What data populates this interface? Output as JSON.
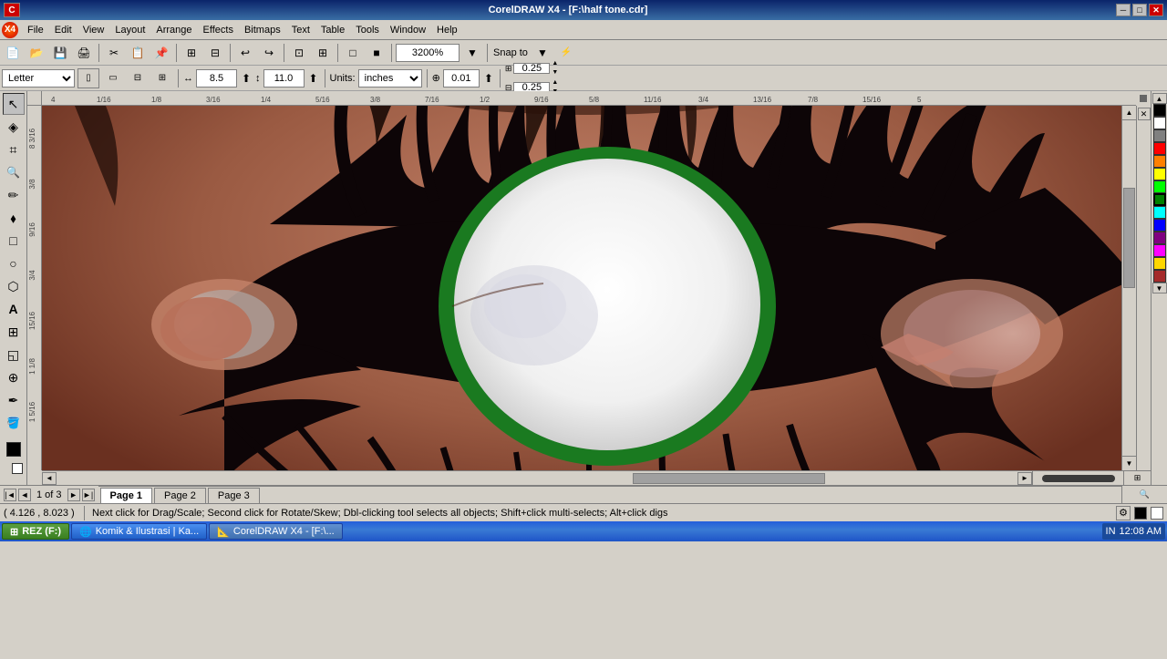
{
  "app": {
    "title": "CorelDRAW X4 - [F:\\half tone.cdr]",
    "logo": "C"
  },
  "titlebar": {
    "title": "CorelDRAW X4 - [F:\\half tone.cdr]",
    "minimize": "─",
    "maximize": "□",
    "close": "✕"
  },
  "menubar": {
    "items": [
      "File",
      "Edit",
      "View",
      "Layout",
      "Arrange",
      "Effects",
      "Bitmaps",
      "Text",
      "Table",
      "Tools",
      "Window",
      "Help"
    ]
  },
  "toolbar1": {
    "new_label": "New",
    "open_label": "Open",
    "save_label": "Save",
    "zoom_value": "3200%",
    "snap_label": "Snap to"
  },
  "toolbar2": {
    "page_size": "Letter",
    "width": "8.5",
    "height": "11.0",
    "units": "inches",
    "nudge": "0.01",
    "offset_x": "0.25",
    "offset_y": "0.25"
  },
  "pages": {
    "current": "1 of 3",
    "tabs": [
      "Page 1",
      "Page 2",
      "Page 3"
    ],
    "active": "Page 1"
  },
  "statusbar": {
    "coords": "( 4.126 , 8.023 )",
    "message": "Next click for Drag/Scale; Second click for Rotate/Skew; Dbl-clicking tool selects all objects; Shift+click multi-selects; Alt+click digs"
  },
  "taskbar": {
    "items": [
      "REZ (F:)",
      "Komik & Ilustrasi | Ka...",
      "CorelDRAW X4 - [F:\\..."
    ],
    "time": "12:08 AM",
    "lang": "IN"
  },
  "palette": {
    "colors": [
      "#000000",
      "#FFFFFF",
      "#FF0000",
      "#00FF00",
      "#0000FF",
      "#FFFF00",
      "#FF00FF",
      "#00FFFF",
      "#800000",
      "#008000",
      "#000080",
      "#808000",
      "#800080",
      "#008080",
      "#C0C0C0",
      "#808080",
      "#FF8080",
      "#80FF80",
      "#8080FF",
      "#FFD700",
      "#FFA500",
      "#A52A2A"
    ]
  },
  "canvas": {
    "zoom": "3200%",
    "page": "Page 1"
  }
}
